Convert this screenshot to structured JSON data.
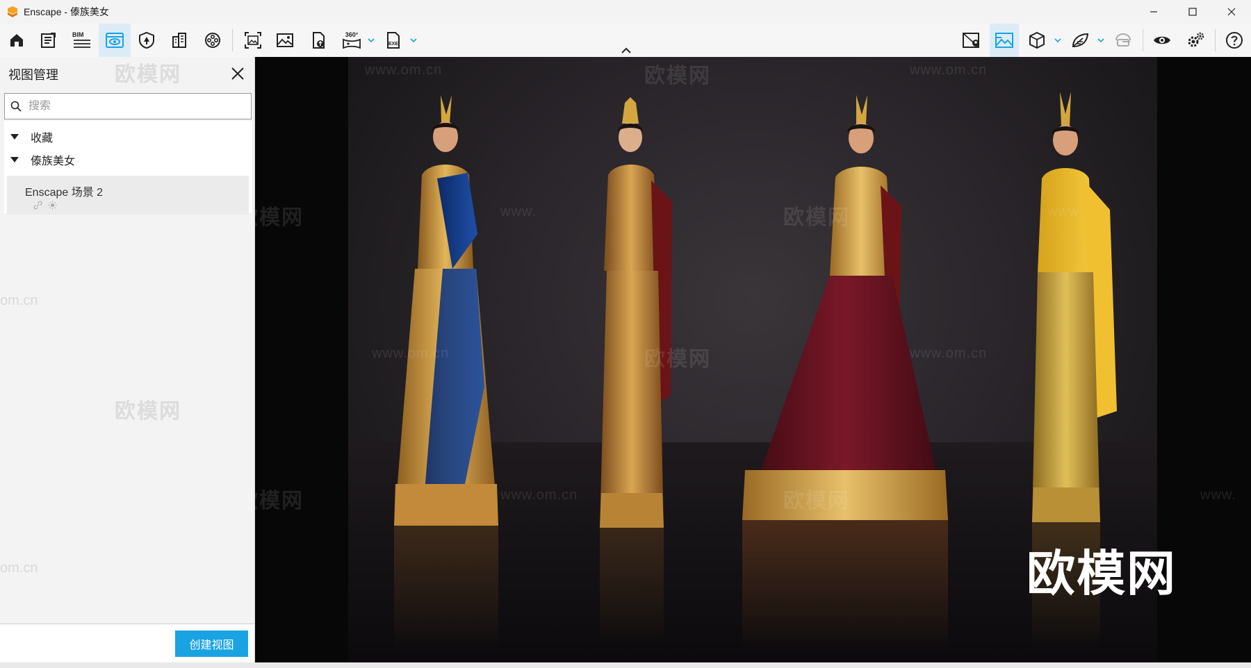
{
  "window": {
    "title": "Enscape - 傣族美女"
  },
  "toolbar": {
    "bim_label": "BIM",
    "pano_label": "360°",
    "exe_label": "EXE"
  },
  "sidebar": {
    "title": "视图管理",
    "search": {
      "placeholder": "搜索",
      "value": ""
    },
    "sections": [
      {
        "label": "收藏",
        "items": []
      },
      {
        "label": "傣族美女",
        "items": [
          {
            "name": "Enscape 场景 2"
          }
        ]
      }
    ],
    "create_view_label": "创建视图"
  },
  "viewport": {
    "watermark_text": "欧模网",
    "watermark_url": "www.om.cn",
    "watermark_url_partial": "om.cn",
    "watermark_www_partial": "www.",
    "logo_text": "欧模网"
  },
  "colors": {
    "accent": "#1aa3e2",
    "active_tool_bg": "#dcecf7"
  }
}
